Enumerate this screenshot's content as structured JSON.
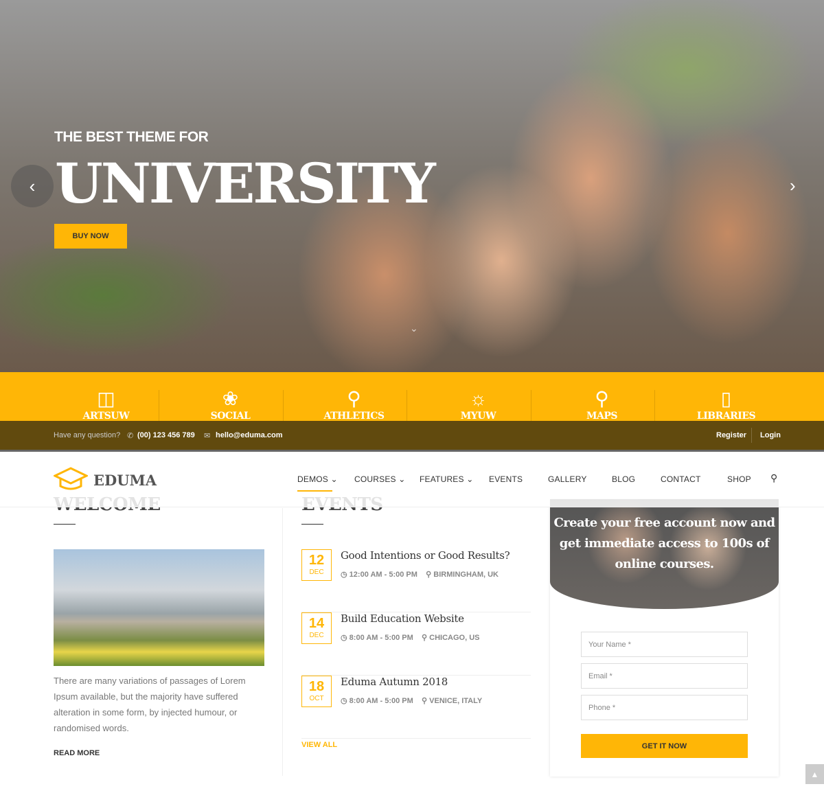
{
  "colors": {
    "accent": "#ffb606",
    "topbar": "#614a0e"
  },
  "hero": {
    "subtitle": "THE BEST THEME FOR",
    "title": "UNIVERSITY",
    "button": "BUY NOW"
  },
  "quick_links": [
    {
      "label": "ARTSUW",
      "icon": "twitch-icon"
    },
    {
      "label": "SOCIAL",
      "icon": "broken-link-icon"
    },
    {
      "label": "ATHLETICS",
      "icon": "trophy-icon"
    },
    {
      "label": "MYUW",
      "icon": "sun-icon"
    },
    {
      "label": "MAPS",
      "icon": "map-marker-icon"
    },
    {
      "label": "LIBRARIES",
      "icon": "book-icon"
    }
  ],
  "topbar": {
    "question": "Have any question?",
    "phone": "(00) 123 456 789",
    "email": "hello@eduma.com",
    "register": "Register",
    "login": "Login"
  },
  "header": {
    "logo": "EDUMA",
    "nav": [
      "DEMOS",
      "COURSES",
      "FEATURES",
      "EVENTS",
      "GALLERY",
      "BLOG",
      "CONTACT",
      "SHOP"
    ]
  },
  "welcome": {
    "title": "WELCOME",
    "text": "There are many variations of passages of Lorem Ipsum available, but the majority have suffered alteration in some form, by injected humour, or randomised words.",
    "read_more": "READ MORE"
  },
  "events": {
    "title": "EVENTS",
    "view_all": "VIEW ALL",
    "items": [
      {
        "day": "12",
        "month": "DEC",
        "title": "Good Intentions or Good Results?",
        "time": "12:00 AM - 5:00 PM",
        "location": "BIRMINGHAM, UK"
      },
      {
        "day": "14",
        "month": "DEC",
        "title": "Build Education Website",
        "time": "8:00 AM - 5:00 PM",
        "location": "CHICAGO, US"
      },
      {
        "day": "18",
        "month": "OCT",
        "title": "Eduma Autumn 2018",
        "time": "8:00 AM - 5:00 PM",
        "location": "VENICE, ITALY"
      }
    ]
  },
  "signup": {
    "headline": "Create your free account now and get immediate access to 100s of online courses.",
    "name_placeholder": "Your Name *",
    "email_placeholder": "Email *",
    "phone_placeholder": "Phone *",
    "button": "GET IT NOW"
  }
}
